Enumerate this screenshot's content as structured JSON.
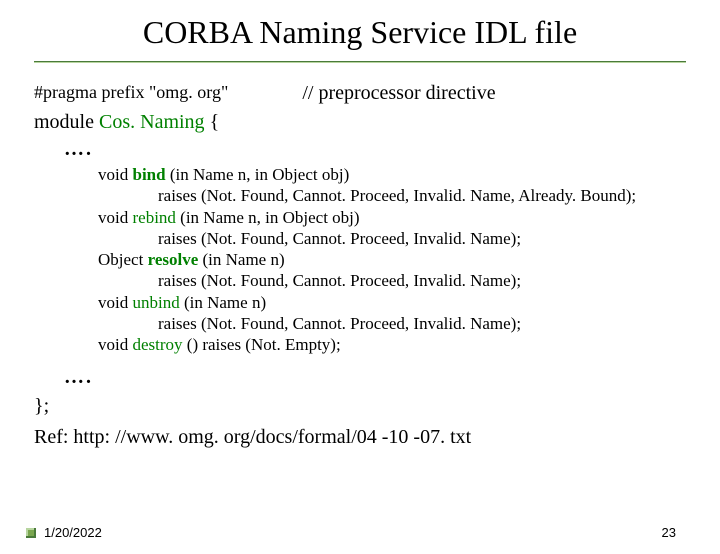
{
  "title": "CORBA Naming Service IDL file",
  "pragma": "#pragma prefix \"omg. org\"",
  "comment": "// preprocessor directive",
  "module_line": {
    "pre": "module ",
    "name": "Cos. Naming",
    "post": " {"
  },
  "dots": "….",
  "code": {
    "l1": {
      "a": "void ",
      "b": "bind",
      "c": " (in Name n, in Object obj)"
    },
    "l2": "raises (Not. Found, Cannot. Proceed, Invalid. Name, Already. Bound);",
    "l3": {
      "a": "void ",
      "b": "rebind",
      "c": " (in Name n, in Object obj)"
    },
    "l4": "raises (Not. Found, Cannot. Proceed, Invalid. Name);",
    "l5": {
      "a": "Object ",
      "b": "resolve",
      "c": " (in Name n)"
    },
    "l6": "raises (Not. Found, Cannot. Proceed, Invalid. Name);",
    "l7": {
      "a": "void ",
      "b": "unbind",
      "c": " (in Name n)"
    },
    "l8": "raises (Not. Found, Cannot. Proceed, Invalid. Name);",
    "l9": {
      "a": "void ",
      "b": "destroy",
      "c": " () raises (Not. Empty);"
    }
  },
  "closing_brace": "};",
  "ref": "Ref:  http: //www. omg. org/docs/formal/04 -10 -07. txt",
  "footer": {
    "date": "1/20/2022",
    "page": "23"
  }
}
